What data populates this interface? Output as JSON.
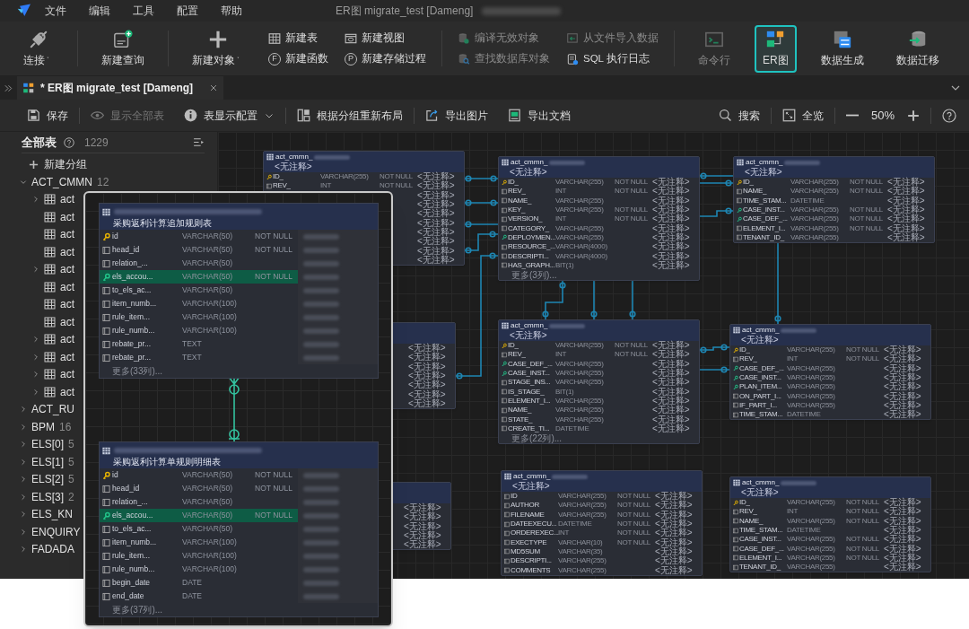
{
  "window": {
    "title": "ER图 migrate_test [Dameng]",
    "menu": [
      "文件",
      "编辑",
      "工具",
      "配置",
      "帮助"
    ]
  },
  "toolbar": {
    "groups": [
      {
        "items": [
          {
            "kind": "large",
            "label": "连接",
            "dropdown": true,
            "disabled": false,
            "selected": false
          }
        ]
      },
      {
        "items": [
          {
            "kind": "large",
            "label": "新建查询",
            "dropdown": false,
            "disabled": false,
            "selected": false
          }
        ]
      },
      {
        "items": [
          {
            "kind": "large",
            "label": "新建对象",
            "dropdown": true,
            "disabled": false,
            "selected": false
          },
          {
            "kind": "small",
            "label": "新建表",
            "disabled": false
          },
          {
            "kind": "small",
            "label": "新建函数",
            "badge": "F",
            "disabled": false
          },
          {
            "kind": "small",
            "label": "新建视图",
            "disabled": false
          },
          {
            "kind": "small",
            "label": "新建存储过程",
            "badge": "P",
            "disabled": false
          }
        ]
      },
      {
        "items": [
          {
            "kind": "small",
            "label": "编译无效对象",
            "disabled": true
          },
          {
            "kind": "small",
            "label": "查找数据库对象",
            "disabled": true
          },
          {
            "kind": "small",
            "label": "从文件导入数据",
            "disabled": true
          },
          {
            "kind": "small",
            "label": "SQL 执行日志",
            "disabled": false
          }
        ]
      },
      {
        "items": [
          {
            "kind": "large",
            "label": "命令行",
            "dropdown": false,
            "disabled": true,
            "selected": false
          },
          {
            "kind": "large",
            "label": "ER图",
            "dropdown": false,
            "disabled": false,
            "selected": true
          },
          {
            "kind": "large",
            "label": "数据生成",
            "dropdown": false,
            "disabled": false,
            "selected": false
          },
          {
            "kind": "large",
            "label": "数据迁移",
            "dropdown": false,
            "disabled": false,
            "selected": false
          }
        ]
      }
    ]
  },
  "tab": {
    "label": "* ER图 migrate_test [Dameng]",
    "selected": true
  },
  "er_toolbar": {
    "groups": [
      [
        {
          "label": "保存",
          "disabled": false,
          "dropdown": false
        }
      ],
      [
        {
          "label": "显示全部表",
          "disabled": true,
          "dropdown": false
        },
        {
          "label": "表显示配置",
          "disabled": false,
          "dropdown": true
        }
      ],
      [
        {
          "label": "根据分组重新布局",
          "disabled": false,
          "dropdown": false
        }
      ],
      [
        {
          "label": "导出图片",
          "disabled": false,
          "dropdown": false
        },
        {
          "label": "导出文档",
          "disabled": false,
          "dropdown": false
        }
      ]
    ],
    "search": "搜索",
    "overview": "全览",
    "zoom": "50%"
  },
  "sidebar": {
    "title": "全部表",
    "count": "1229",
    "new_group": "新建分组",
    "groups": [
      {
        "label": "ACT_CMMN",
        "count": "12",
        "expanded": true,
        "children": [
          {
            "label": "act",
            "expandable": true
          },
          {
            "label": "act",
            "expandable": false
          },
          {
            "label": "act",
            "expandable": false
          },
          {
            "label": "act",
            "expandable": false
          },
          {
            "label": "act",
            "expandable": true
          },
          {
            "label": "act",
            "expandable": false
          },
          {
            "label": "act",
            "expandable": false
          },
          {
            "label": "act",
            "expandable": false
          },
          {
            "label": "act",
            "expandable": true
          },
          {
            "label": "act",
            "expandable": true
          },
          {
            "label": "act",
            "expandable": true
          },
          {
            "label": "act",
            "expandable": true
          }
        ]
      },
      {
        "label": "ACT_RU",
        "expanded": false
      },
      {
        "label": "BPM",
        "count": "16",
        "expanded": false
      },
      {
        "label": "ELS[0]",
        "count": "5",
        "expanded": false
      },
      {
        "label": "ELS[1]",
        "count": "5",
        "expanded": false
      },
      {
        "label": "ELS[2]",
        "count": "5",
        "expanded": false
      },
      {
        "label": "ELS[3]",
        "count": "2",
        "expanded": false
      },
      {
        "label": "ELS_KN",
        "expanded": false
      },
      {
        "label": "ENQUIRY",
        "expanded": false
      },
      {
        "label": "FADADA",
        "expanded": false
      }
    ]
  },
  "canvas": {
    "entities": [
      {
        "title": "act_cmmn_",
        "subtitle": "<无注释>",
        "rows": [
          {
            "kind": "pk",
            "name": "ID_",
            "type": "VARCHAR(255)",
            "null": "NOT NULL",
            "comment": "<无注释>"
          },
          {
            "kind": "col",
            "name": "REV_",
            "type": "INT",
            "null": "NOT NULL",
            "comment": "<无注释>"
          },
          {
            "comment": "<无注释>"
          },
          {
            "comment": "<无注释>"
          },
          {
            "comment": "<无注释>"
          },
          {
            "comment": "<无注释>"
          },
          {
            "comment": "<无注释>"
          },
          {
            "comment": "<无注释>"
          },
          {
            "comment": "<无注释>"
          },
          {
            "comment": "<无注释>"
          }
        ]
      },
      {
        "title": "act_cmmn_",
        "subtitle": "<无注释>",
        "rows": [
          {
            "kind": "pk",
            "name": "ID_",
            "type": "VARCHAR(255)",
            "null": "NOT NULL",
            "comment": "<无注释>"
          },
          {
            "kind": "col",
            "name": "REV_",
            "type": "INT",
            "null": "NOT NULL",
            "comment": "<无注释>"
          },
          {
            "kind": "col",
            "name": "NAME_",
            "type": "VARCHAR(255)",
            "comment": "<无注释>"
          },
          {
            "kind": "col",
            "name": "KEY_",
            "type": "VARCHAR(255)",
            "null": "NOT NULL",
            "comment": "<无注释>"
          },
          {
            "kind": "col",
            "name": "VERSION_",
            "type": "INT",
            "null": "NOT NULL",
            "comment": "<无注释>"
          },
          {
            "kind": "col",
            "name": "CATEGORY_",
            "type": "VARCHAR(255)",
            "comment": "<无注释>"
          },
          {
            "kind": "fk",
            "name": "DEPLOYMEN...",
            "type": "VARCHAR(255)",
            "comment": "<无注释>"
          },
          {
            "kind": "col",
            "name": "RESOURCE_...",
            "type": "VARCHAR(4000)",
            "comment": "<无注释>"
          },
          {
            "kind": "col",
            "name": "DESCRIPTI...",
            "type": "VARCHAR(4000)",
            "comment": "<无注释>"
          },
          {
            "kind": "col",
            "name": "HAS_GRAPH...",
            "type": "BIT(1)",
            "comment": "<无注释>"
          }
        ],
        "more": "更多(3列)..."
      },
      {
        "title": "act_cmmn_",
        "subtitle": "<无注释>",
        "rows": [
          {
            "kind": "pk",
            "name": "ID_",
            "type": "VARCHAR(255)",
            "null": "NOT NULL",
            "comment": "<无注释>"
          },
          {
            "kind": "col",
            "name": "NAME_",
            "type": "VARCHAR(255)",
            "null": "NOT NULL",
            "comment": "<无注释>"
          },
          {
            "kind": "col",
            "name": "TIME_STAM...",
            "type": "DATETIME",
            "comment": "<无注释>"
          },
          {
            "kind": "fk",
            "name": "CASE_INST...",
            "type": "VARCHAR(255)",
            "null": "NOT NULL",
            "comment": "<无注释>"
          },
          {
            "kind": "fk",
            "name": "CASE_DEF_...",
            "type": "VARCHAR(255)",
            "null": "NOT NULL",
            "comment": "<无注释>"
          },
          {
            "kind": "col",
            "name": "ELEMENT_I...",
            "type": "VARCHAR(255)",
            "null": "NOT NULL",
            "comment": "<无注释>"
          },
          {
            "kind": "col",
            "name": "TENANT_ID_",
            "type": "VARCHAR(255)",
            "comment": "<无注释>"
          }
        ]
      },
      {
        "rows": [
          {
            "comment": "<无注释>"
          },
          {
            "comment": "<无注释>"
          },
          {
            "comment": "<无注释>"
          },
          {
            "comment": "<无注释>"
          },
          {
            "comment": "<无注释>"
          },
          {
            "comment": "<无注释>"
          },
          {
            "comment": "<无注释>"
          }
        ]
      },
      {
        "title": "act_cmmn_",
        "subtitle": "<无注释>",
        "rows": [
          {
            "kind": "pk",
            "name": "ID_",
            "type": "VARCHAR(255)",
            "null": "NOT NULL",
            "comment": "<无注释>"
          },
          {
            "kind": "col",
            "name": "REV_",
            "type": "INT",
            "null": "NOT NULL",
            "comment": "<无注释>"
          },
          {
            "kind": "fk",
            "name": "CASE_DEF_...",
            "type": "VARCHAR(255)",
            "comment": "<无注释>"
          },
          {
            "kind": "fk",
            "name": "CASE_INST...",
            "type": "VARCHAR(255)",
            "comment": "<无注释>"
          },
          {
            "kind": "col",
            "name": "STAGE_INS...",
            "type": "VARCHAR(255)",
            "comment": "<无注释>"
          },
          {
            "kind": "col",
            "name": "IS_STAGE_",
            "type": "BIT(1)",
            "comment": "<无注释>"
          },
          {
            "kind": "col",
            "name": "ELEMENT_I...",
            "type": "VARCHAR(255)",
            "comment": "<无注释>"
          },
          {
            "kind": "col",
            "name": "NAME_",
            "type": "VARCHAR(255)",
            "comment": "<无注释>"
          },
          {
            "kind": "col",
            "name": "STATE_",
            "type": "VARCHAR(255)",
            "comment": "<无注释>"
          },
          {
            "kind": "col",
            "name": "CREATE_TI...",
            "type": "DATETIME",
            "comment": "<无注释>"
          }
        ],
        "more": "更多(22列)..."
      },
      {
        "title": "act_cmmn_",
        "subtitle": "<无注释>",
        "rows": [
          {
            "kind": "pk",
            "name": "ID_",
            "type": "VARCHAR(255)",
            "null": "NOT NULL",
            "comment": "<无注释>"
          },
          {
            "kind": "col",
            "name": "REV_",
            "type": "INT",
            "null": "NOT NULL",
            "comment": "<无注释>"
          },
          {
            "kind": "fk",
            "name": "CASE_DEF_...",
            "type": "VARCHAR(255)",
            "comment": "<无注释>"
          },
          {
            "kind": "fk",
            "name": "CASE_INST...",
            "type": "VARCHAR(255)",
            "comment": "<无注释>"
          },
          {
            "kind": "fk",
            "name": "PLAN_ITEM...",
            "type": "VARCHAR(255)",
            "comment": "<无注释>"
          },
          {
            "kind": "col",
            "name": "ON_PART_I...",
            "type": "VARCHAR(255)",
            "comment": "<无注释>"
          },
          {
            "kind": "col",
            "name": "IF_PART_I...",
            "type": "VARCHAR(255)",
            "comment": "<无注释>"
          },
          {
            "kind": "col",
            "name": "TIME_STAM...",
            "type": "DATETIME",
            "comment": "<无注释>"
          }
        ]
      },
      {
        "rows": [
          {
            "comment": "<无注释>"
          },
          {
            "comment": "<无注释>"
          },
          {
            "comment": "<无注释>"
          },
          {
            "comment": "<无注释>"
          },
          {
            "comment": "<无注释>"
          }
        ]
      },
      {
        "title": "act_cmmn_",
        "subtitle": "<无注释>",
        "rows": [
          {
            "kind": "col",
            "name": "ID",
            "type": "VARCHAR(255)",
            "null": "NOT NULL",
            "comment": "<无注释>"
          },
          {
            "kind": "col",
            "name": "AUTHOR",
            "type": "VARCHAR(255)",
            "null": "NOT NULL",
            "comment": "<无注释>"
          },
          {
            "kind": "col",
            "name": "FILENAME",
            "type": "VARCHAR(255)",
            "null": "NOT NULL",
            "comment": "<无注释>"
          },
          {
            "kind": "col",
            "name": "DATEEXECU...",
            "type": "DATETIME",
            "null": "NOT NULL",
            "comment": "<无注释>"
          },
          {
            "kind": "col",
            "name": "ORDEREXEC...",
            "type": "INT",
            "null": "NOT NULL",
            "comment": "<无注释>"
          },
          {
            "kind": "col",
            "name": "EXECTYPE",
            "type": "VARCHAR(10)",
            "null": "NOT NULL",
            "comment": "<无注释>"
          },
          {
            "kind": "col",
            "name": "MD5SUM",
            "type": "VARCHAR(35)",
            "comment": "<无注释>"
          },
          {
            "kind": "col",
            "name": "DESCRIPTI...",
            "type": "VARCHAR(255)",
            "comment": "<无注释>"
          },
          {
            "kind": "col",
            "name": "COMMENTS",
            "type": "VARCHAR(255)",
            "comment": "<无注释>"
          }
        ]
      },
      {
        "title": "act_cmmn_",
        "subtitle": "<无注释>",
        "rows": [
          {
            "kind": "pk",
            "name": "ID_",
            "type": "VARCHAR(255)",
            "null": "NOT NULL",
            "comment": "<无注释>"
          },
          {
            "kind": "col",
            "name": "REV_",
            "type": "INT",
            "null": "NOT NULL",
            "comment": "<无注释>"
          },
          {
            "kind": "col",
            "name": "NAME_",
            "type": "VARCHAR(255)",
            "null": "NOT NULL",
            "comment": "<无注释>"
          },
          {
            "kind": "col",
            "name": "TIME_STAM...",
            "type": "DATETIME",
            "comment": "<无注释>"
          },
          {
            "kind": "col",
            "name": "CASE_INST...",
            "type": "VARCHAR(255)",
            "null": "NOT NULL",
            "comment": "<无注释>"
          },
          {
            "kind": "col",
            "name": "CASE_DEF_...",
            "type": "VARCHAR(255)",
            "null": "NOT NULL",
            "comment": "<无注释>"
          },
          {
            "kind": "col",
            "name": "ELEMENT_I...",
            "type": "VARCHAR(255)",
            "null": "NOT NULL",
            "comment": "<无注释>"
          },
          {
            "kind": "col",
            "name": "TENANT_ID_",
            "type": "VARCHAR(255)",
            "comment": "<无注释>"
          }
        ]
      }
    ]
  },
  "inset": {
    "entities": [
      {
        "subtitle": "采购返利计算追加规则表",
        "rows": [
          {
            "kind": "pk",
            "name": "id",
            "type": "VARCHAR(50)",
            "null": "NOT NULL",
            "selected": false
          },
          {
            "kind": "col",
            "name": "head_id",
            "type": "VARCHAR(50)",
            "null": "NOT NULL",
            "selected": false
          },
          {
            "kind": "col",
            "name": "relation_...",
            "type": "VARCHAR(50)",
            "selected": false
          },
          {
            "kind": "fk",
            "name": "els_accou...",
            "type": "VARCHAR(50)",
            "null": "NOT NULL",
            "selected": true
          },
          {
            "kind": "col",
            "name": "to_els_ac...",
            "type": "VARCHAR(50)",
            "selected": false
          },
          {
            "kind": "col",
            "name": "item_numb...",
            "type": "VARCHAR(100)",
            "selected": false
          },
          {
            "kind": "col",
            "name": "rule_item...",
            "type": "VARCHAR(100)",
            "selected": false
          },
          {
            "kind": "col",
            "name": "rule_numb...",
            "type": "VARCHAR(100)",
            "selected": false
          },
          {
            "kind": "col",
            "name": "rebate_pr...",
            "type": "TEXT",
            "selected": false
          },
          {
            "kind": "col",
            "name": "rebate_pr...",
            "type": "TEXT",
            "selected": false
          }
        ],
        "more": "更多(33列)..."
      },
      {
        "subtitle": "采购返利计算单规则明细表",
        "rows": [
          {
            "kind": "pk",
            "name": "id",
            "type": "VARCHAR(50)",
            "null": "NOT NULL",
            "selected": false
          },
          {
            "kind": "col",
            "name": "head_id",
            "type": "VARCHAR(50)",
            "null": "NOT NULL",
            "selected": false
          },
          {
            "kind": "col",
            "name": "relation_...",
            "type": "VARCHAR(50)",
            "selected": false
          },
          {
            "kind": "fk",
            "name": "els_accou...",
            "type": "VARCHAR(50)",
            "null": "NOT NULL",
            "selected": true
          },
          {
            "kind": "col",
            "name": "to_els_ac...",
            "type": "VARCHAR(50)",
            "selected": false
          },
          {
            "kind": "col",
            "name": "item_numb...",
            "type": "VARCHAR(100)",
            "selected": false
          },
          {
            "kind": "col",
            "name": "rule_item...",
            "type": "VARCHAR(100)",
            "selected": false
          },
          {
            "kind": "col",
            "name": "rule_numb...",
            "type": "VARCHAR(100)",
            "selected": false
          },
          {
            "kind": "col",
            "name": "begin_date",
            "type": "DATE",
            "selected": false
          },
          {
            "kind": "col",
            "name": "end_date",
            "type": "DATE",
            "selected": false
          }
        ],
        "more": "更多(37列)..."
      }
    ]
  }
}
